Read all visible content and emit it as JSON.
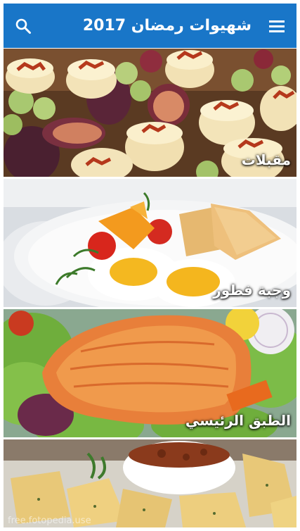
{
  "header": {
    "title": "شهيوات رمضان 2017",
    "menu_icon": "menu-icon",
    "search_icon": "search-icon",
    "color": "#1976c8"
  },
  "categories": [
    {
      "label": "مقبلات"
    },
    {
      "label": "وجبة فطور"
    },
    {
      "label": "الطبق الرئيسي"
    },
    {
      "label": ""
    }
  ],
  "watermark": "free.fotopedia.use"
}
